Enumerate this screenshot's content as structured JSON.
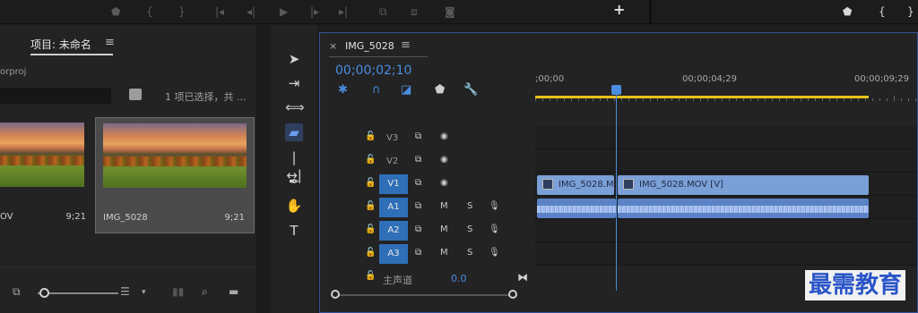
{
  "project": {
    "tab": "项目: 未命名",
    "menu": "≡",
    "file": "orproj",
    "selection_info": "1 项已选择，共 ...",
    "clips": [
      {
        "name": "OV",
        "duration": "9;21"
      },
      {
        "name": "IMG_5028",
        "duration": "9;21"
      }
    ]
  },
  "timeline": {
    "close": "×",
    "title": "IMG_5028",
    "menu": "≡",
    "timecode": "00;00;02;10",
    "ruler": [
      ";00;00",
      "00;00;04;29",
      "00;00;09;29"
    ],
    "tracks": [
      {
        "name": "V3",
        "active": false
      },
      {
        "name": "V2",
        "active": false
      },
      {
        "name": "V1",
        "active": true
      },
      {
        "name": "A1",
        "active": true
      },
      {
        "name": "A2",
        "active": true
      },
      {
        "name": "A3",
        "active": true
      }
    ],
    "video_clips": [
      "IMG_5028.M",
      "IMG_5028.MOV [V]"
    ],
    "master_label": "主声道",
    "master_value": "0.0",
    "buttons": {
      "mute": "M",
      "solo": "S"
    }
  },
  "watermark": "最需教育",
  "colors": {
    "accent": "#4a8de0",
    "track_active": "#2f6fb7",
    "video_clip": "#7b9fd7",
    "audio_clip": "#5a82c5",
    "work_area": "#e8c21c"
  }
}
